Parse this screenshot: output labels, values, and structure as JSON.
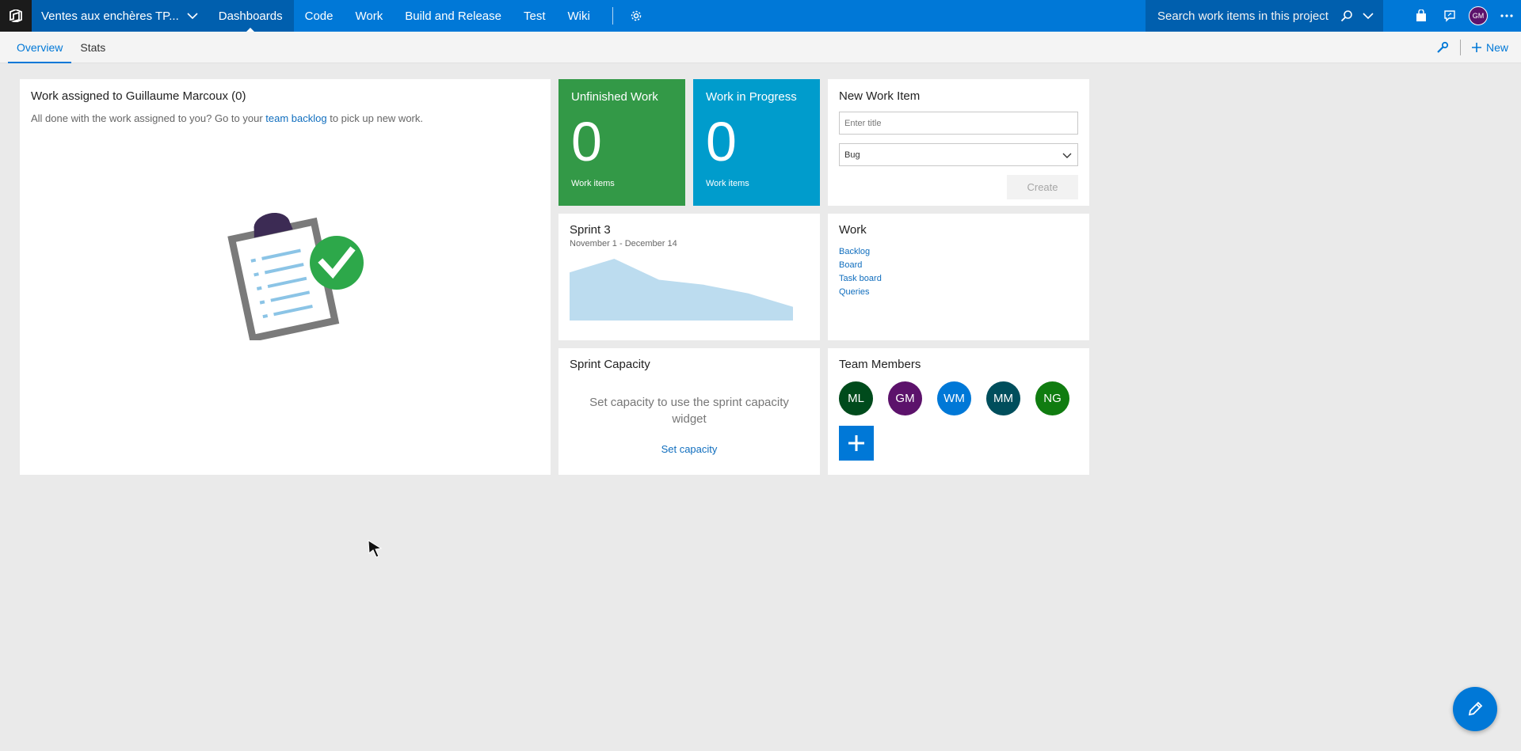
{
  "topbar": {
    "project_name": "Ventes aux enchères TP...",
    "hubs": [
      "Dashboards",
      "Code",
      "Work",
      "Build and Release",
      "Test",
      "Wiki"
    ],
    "search_placeholder": "Search work items in this project",
    "user_initials": "GM"
  },
  "subnav": {
    "tabs": [
      "Overview",
      "Stats"
    ],
    "new_label": "New"
  },
  "assigned_widget": {
    "title": "Work assigned to Guillaume Marcoux (0)",
    "desc_before": "All done with the work assigned to you? Go to your ",
    "desc_link": "team backlog",
    "desc_after": " to pick up new work."
  },
  "unfinished_widget": {
    "title": "Unfinished Work",
    "count": "0",
    "sub": "Work items"
  },
  "progress_widget": {
    "title": "Work in Progress",
    "count": "0",
    "sub": "Work items"
  },
  "new_item_widget": {
    "title": "New Work Item",
    "placeholder": "Enter title",
    "type": "Bug",
    "create_label": "Create"
  },
  "sprint_widget": {
    "title": "Sprint 3",
    "dates": "November 1 - December 14"
  },
  "chart_data": {
    "type": "area",
    "values": [
      78,
      100,
      66,
      58,
      44,
      22
    ],
    "color": "#bcdcef"
  },
  "work_widget": {
    "title": "Work",
    "links": [
      "Backlog",
      "Board",
      "Task board",
      "Queries"
    ]
  },
  "capacity_widget": {
    "title": "Sprint Capacity",
    "message": "Set capacity to use the sprint capacity widget",
    "link": "Set capacity"
  },
  "team_widget": {
    "title": "Team Members",
    "members": [
      {
        "initials": "ML",
        "color": "#004b1c"
      },
      {
        "initials": "GM",
        "color": "#5c126b"
      },
      {
        "initials": "WM",
        "color": "#0078d7"
      },
      {
        "initials": "MM",
        "color": "#004e5c"
      },
      {
        "initials": "NG",
        "color": "#107c10"
      }
    ]
  },
  "colors": {
    "accent": "#0078d7",
    "unfinished": "#339947",
    "in_progress": "#009ccc"
  }
}
